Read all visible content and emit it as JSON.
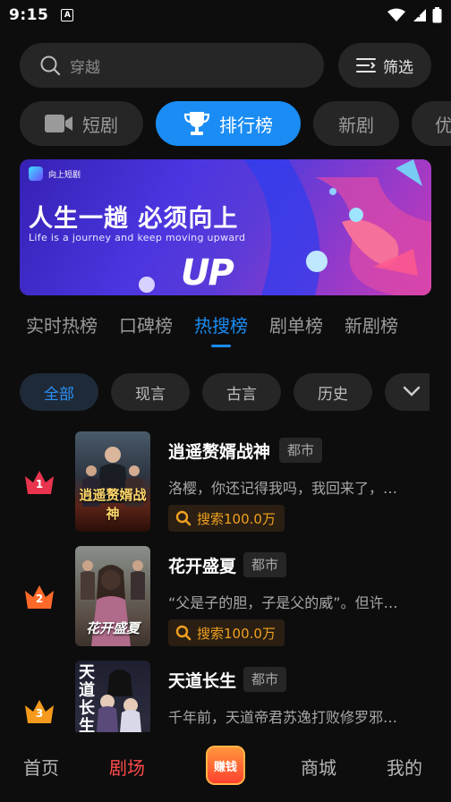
{
  "status_bar": {
    "time": "9:15",
    "app_badge": "A"
  },
  "search": {
    "placeholder": "穿越",
    "filter_label": "筛选"
  },
  "top_tabs": [
    {
      "label": "短剧",
      "icon": "video-camera-icon",
      "active": false
    },
    {
      "label": "排行榜",
      "icon": "trophy-icon",
      "active": true
    },
    {
      "label": "新剧",
      "active": false
    },
    {
      "label": "优",
      "active": false
    }
  ],
  "banner": {
    "logo_text": "向上短剧",
    "title": "人生一趟  必须向上",
    "subtitle": "Life is a journey and  keep moving upward",
    "mark": "UP"
  },
  "rank_tabs": [
    {
      "label": "实时热榜",
      "active": false
    },
    {
      "label": "口碑榜",
      "active": false
    },
    {
      "label": "热搜榜",
      "active": true
    },
    {
      "label": "剧单榜",
      "active": false
    },
    {
      "label": "新剧榜",
      "active": false
    }
  ],
  "genre_chips": [
    {
      "label": "全部",
      "active": true
    },
    {
      "label": "现言",
      "active": false
    },
    {
      "label": "古言",
      "active": false
    },
    {
      "label": "历史",
      "active": false
    }
  ],
  "dramas": [
    {
      "rank": "1",
      "title": "逍遥赘婿战神",
      "tag": "都市",
      "desc": "洛樱，你还记得我吗，我回来了，…",
      "search": "搜索100.0万",
      "poster_text": "逍遥赘婿战神",
      "badge_color": "#e8344e"
    },
    {
      "rank": "2",
      "title": "花开盛夏",
      "tag": "都市",
      "desc": "“父是子的胆，子是父的威”。但许…",
      "search": "搜索100.0万",
      "poster_text": "花开盛夏",
      "badge_color": "#ff6a2a"
    },
    {
      "rank": "3",
      "title": "天道长生",
      "tag": "都市",
      "desc": "千年前，天道帝君苏逸打败修罗邪…",
      "poster_text": "天道长生",
      "badge_color": "#f59a1c"
    }
  ],
  "bottom_nav": {
    "home": "首页",
    "theater": "剧场",
    "earn": "赚钱",
    "mall": "商城",
    "mine": "我的"
  },
  "colors": {
    "accent": "#1a8cf4",
    "nav_active": "#ff4b4b",
    "search_hot": "#f0a020"
  }
}
